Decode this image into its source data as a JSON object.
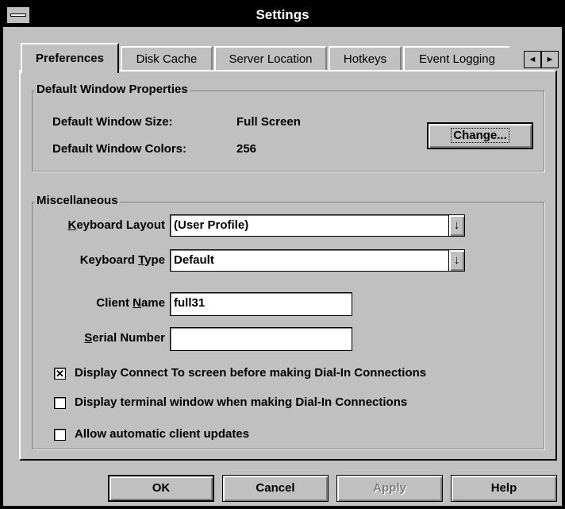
{
  "window": {
    "title": "Settings"
  },
  "tabs": [
    {
      "label": "Preferences",
      "selected": true
    },
    {
      "label": "Disk Cache",
      "selected": false
    },
    {
      "label": "Server Location",
      "selected": false
    },
    {
      "label": "Hotkeys",
      "selected": false
    },
    {
      "label": "Event Logging",
      "selected": false
    }
  ],
  "tab_scroll": {
    "left_icon": "◄",
    "right_icon": "►"
  },
  "default_window": {
    "legend": "Default Window Properties",
    "size_label": "Default Window Size:",
    "size_value": "Full Screen",
    "colors_label": "Default Window Colors:",
    "colors_value": "256",
    "change_button": "Change..."
  },
  "misc": {
    "legend": "Miscellaneous",
    "keyboard_layout": {
      "label": "Keyboard Layout",
      "mnemonic": "K",
      "value": "(User Profile)"
    },
    "keyboard_type": {
      "label": "Keyboard Type",
      "mnemonic": "T",
      "value": "Default"
    },
    "client_name": {
      "label": "Client Name",
      "mnemonic": "N",
      "value": "full31"
    },
    "serial_number": {
      "label": "Serial Number",
      "mnemonic": "S",
      "value": ""
    },
    "checkboxes": [
      {
        "label": "Display Connect To screen before making Dial-In Connections",
        "checked": true
      },
      {
        "label": "Display terminal window when making Dial-In Connections",
        "checked": false
      },
      {
        "label": "Allow automatic client updates",
        "checked": false
      }
    ],
    "dropdown_icon": "↓"
  },
  "buttons": {
    "ok": "OK",
    "cancel": "Cancel",
    "apply": "Apply",
    "help": "Help"
  }
}
